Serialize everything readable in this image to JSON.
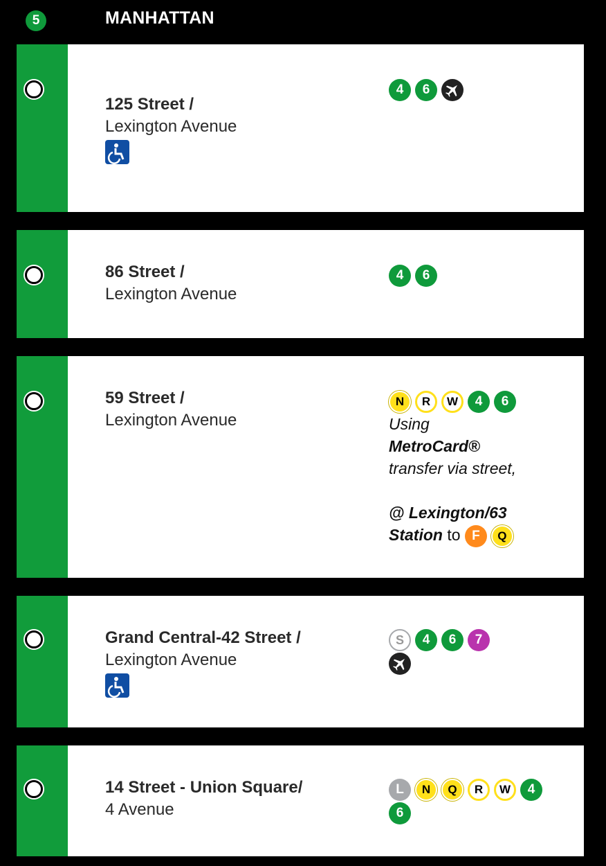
{
  "header": {
    "route": "5",
    "borough": "MANHATTAN"
  },
  "stations": [
    {
      "line1": "125 Street /",
      "line2": "Lexington Avenue",
      "ada": true,
      "transfers": [
        [
          "4",
          "6",
          "airport"
        ]
      ]
    },
    {
      "line1": "86 Street /",
      "line2": "Lexington Avenue",
      "ada": false,
      "transfers": [
        [
          "4",
          "6"
        ]
      ]
    },
    {
      "line1": "59 Street /",
      "line2": "Lexington Avenue",
      "ada": false,
      "transfers": [
        [
          "N",
          "R",
          "W",
          "4",
          "6"
        ]
      ],
      "note": {
        "using": "Using",
        "metrocard": "MetroCard®",
        "transfer": "transfer via street,",
        "at": "@ Lexington/63",
        "station": "Station",
        "to": "to",
        "lines": [
          "F",
          "Q"
        ]
      }
    },
    {
      "line1": "Grand Central-42 Street /",
      "line2": "Lexington Avenue",
      "ada": true,
      "transfers": [
        [
          "S",
          "4",
          "6",
          "7"
        ],
        [
          "airport"
        ]
      ]
    },
    {
      "line1": "14 Street - Union Square/",
      "line2": "4 Avenue",
      "ada": false,
      "transfers": [
        [
          "L",
          "N",
          "Q",
          "R",
          "W",
          "4"
        ],
        [
          "6"
        ]
      ]
    }
  ]
}
